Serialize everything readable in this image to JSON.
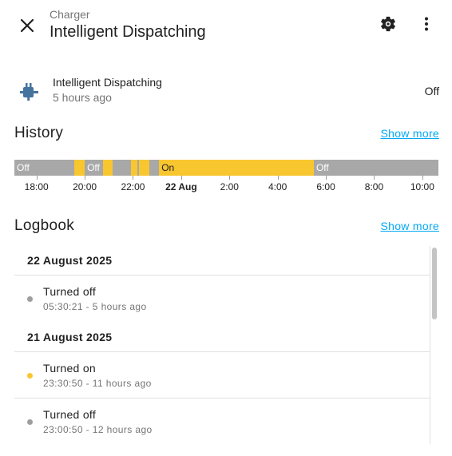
{
  "header": {
    "breadcrumb": "Charger",
    "title": "Intelligent Dispatching",
    "close_icon": "close-icon",
    "settings_icon": "gear-icon",
    "more_icon": "more-vertical-icon"
  },
  "entity": {
    "icon": "ev-plug-icon",
    "icon_color": "#44739e",
    "name": "Intelligent Dispatching",
    "last_changed": "5 hours ago",
    "state": "Off"
  },
  "history": {
    "heading": "History",
    "show_more": "Show more",
    "colors": {
      "off": "#a8a8a8",
      "on": "#f8c62f"
    },
    "segments": [
      {
        "state": "off",
        "label": "Off",
        "start": "17:05",
        "end": "19:35"
      },
      {
        "state": "on",
        "label": "",
        "start": "19:35",
        "end": "20:00"
      },
      {
        "state": "off",
        "label": "Off",
        "start": "20:00",
        "end": "20:45"
      },
      {
        "state": "on",
        "label": "",
        "start": "20:45",
        "end": "21:10"
      },
      {
        "state": "off",
        "label": "",
        "start": "21:10",
        "end": "21:55"
      },
      {
        "state": "on",
        "label": "",
        "start": "21:55",
        "end": "22:10"
      },
      {
        "state": "off",
        "label": "",
        "start": "22:10",
        "end": "22:15"
      },
      {
        "state": "on",
        "label": "",
        "start": "22:15",
        "end": "22:40"
      },
      {
        "state": "off",
        "label": "",
        "start": "22:40",
        "end": "23:05"
      },
      {
        "state": "on",
        "label": "On",
        "start": "23:05",
        "end": "05:30"
      },
      {
        "state": "off",
        "label": "Off",
        "start": "05:30",
        "end": "10:40"
      }
    ],
    "ticks": [
      {
        "label": "18:00",
        "bold": false
      },
      {
        "label": "20:00",
        "bold": false
      },
      {
        "label": "22:00",
        "bold": false
      },
      {
        "label": "22 Aug",
        "bold": true
      },
      {
        "label": "2:00",
        "bold": false
      },
      {
        "label": "4:00",
        "bold": false
      },
      {
        "label": "6:00",
        "bold": false
      },
      {
        "label": "8:00",
        "bold": false
      },
      {
        "label": "10:00",
        "bold": false
      }
    ]
  },
  "logbook": {
    "heading": "Logbook",
    "show_more": "Show more",
    "groups": [
      {
        "date": "22 August 2025",
        "entries": [
          {
            "message": "Turned off",
            "time": "05:30:21 - 5 hours ago",
            "dot_color": "#9e9e9e"
          }
        ]
      },
      {
        "date": "21 August 2025",
        "entries": [
          {
            "message": "Turned on",
            "time": "23:30:50 - 11 hours ago",
            "dot_color": "#f8c62f"
          },
          {
            "message": "Turned off",
            "time": "23:00:50 - 12 hours ago",
            "dot_color": "#9e9e9e"
          }
        ]
      }
    ]
  }
}
